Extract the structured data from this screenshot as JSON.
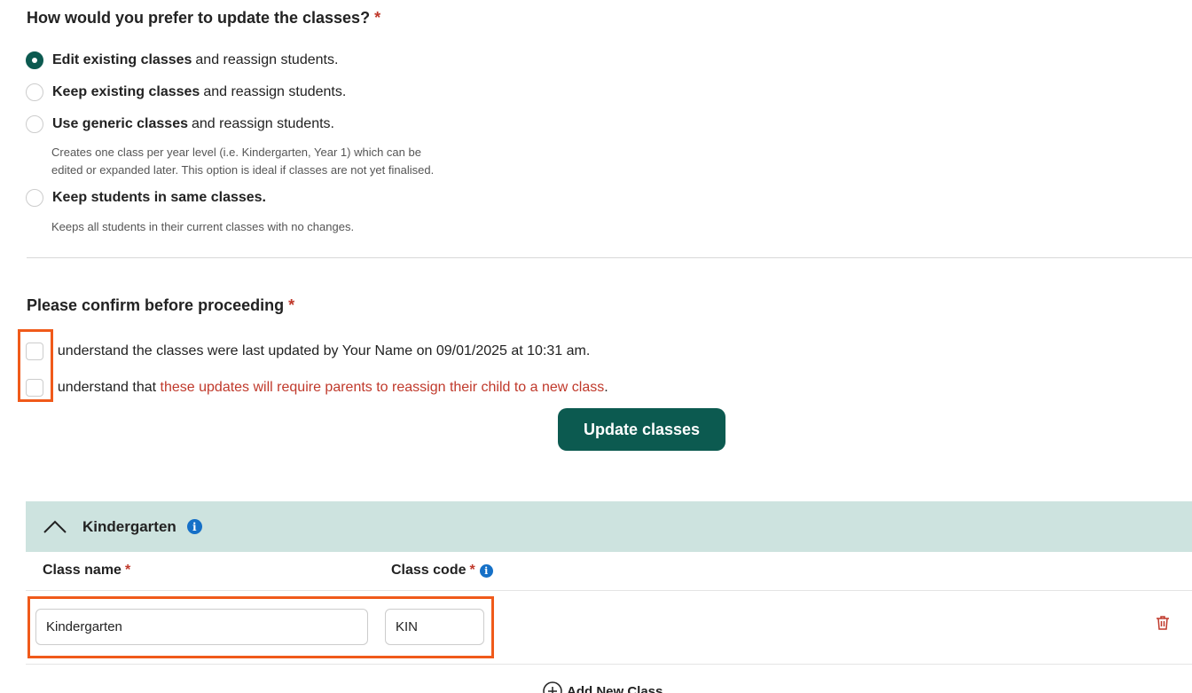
{
  "question": {
    "title": "How would you prefer to update the classes?",
    "required_mark": "*",
    "options": [
      {
        "bold": "Edit existing classes",
        "rest": "and reassign students.",
        "checked": true
      },
      {
        "bold": "Keep existing classes",
        "rest": "and reassign students.",
        "checked": false
      },
      {
        "bold": "Use generic classes",
        "rest": "and reassign students.",
        "checked": false,
        "desc_line1": "Creates one class per year level (i.e. Kindergarten, Year 1) which can be",
        "desc_line2": "edited or expanded later. This option is ideal if classes are not yet finalised."
      },
      {
        "bold": "Keep students in same classes.",
        "rest": "",
        "checked": false,
        "desc_line1": "Keeps all students in their current classes with no changes."
      }
    ]
  },
  "confirm": {
    "title": "Please confirm before proceeding",
    "required_mark": "*",
    "check1": "I understand the classes were last updated by Your Name on 09/01/2025 at 10:31 am.",
    "check2_prefix": "I understand that ",
    "check2_red": "these updates will require parents to reassign their child to a new class",
    "check2_suffix": ".",
    "button_label": "Update classes"
  },
  "section": {
    "title": "Kindergarten",
    "col_class_name": "Class name",
    "col_class_code": "Class code",
    "required_mark": "*",
    "row": {
      "class_name": "Kindergarten",
      "class_code": "KIN"
    },
    "add_label": "Add New Class"
  },
  "colors": {
    "primary": "#0c5a50",
    "required": "#c0392b",
    "section_bg": "#cde3df",
    "info": "#1570c7",
    "highlight": "#f05a1a"
  }
}
